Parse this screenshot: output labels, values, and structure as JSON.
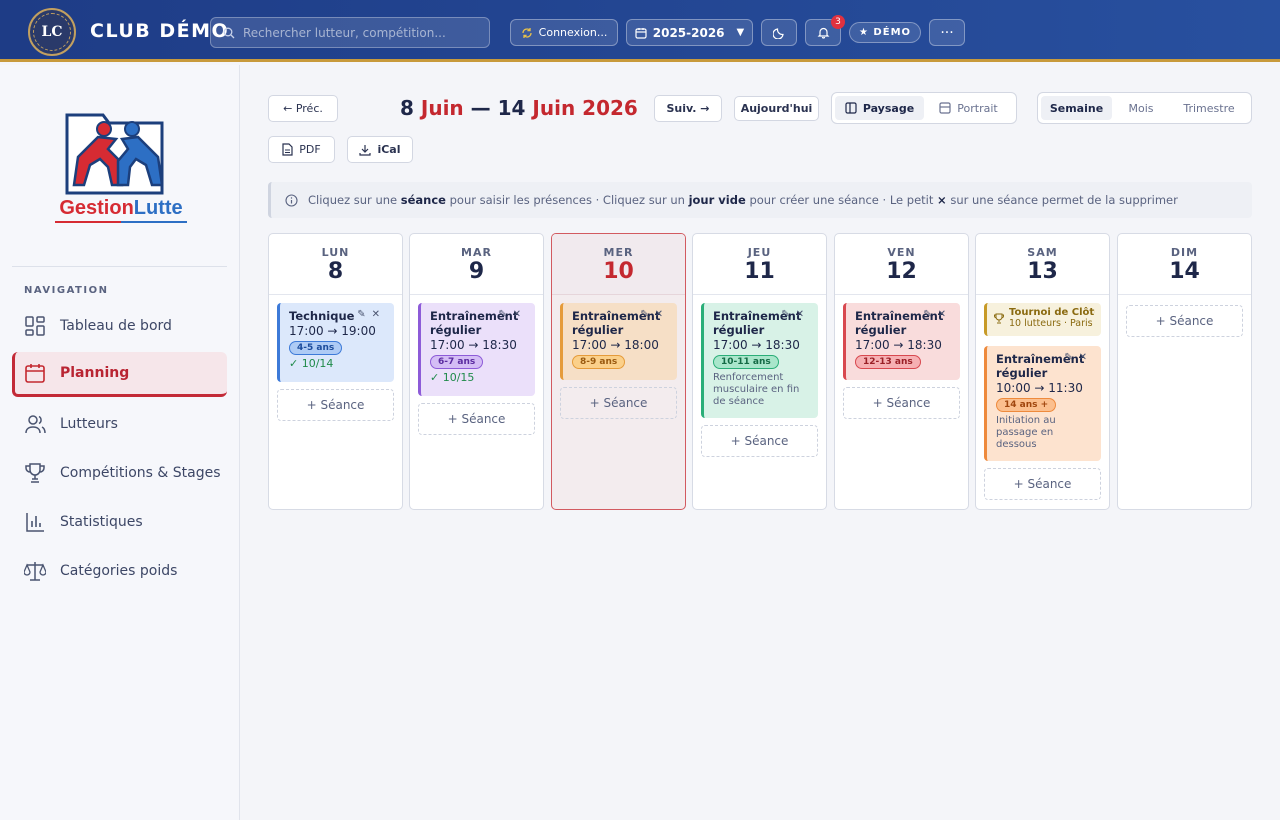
{
  "topbar": {
    "logo_initials": "LC",
    "club_name": "CLUB DÉMO",
    "search_placeholder": "Rechercher lutteur, compétition...",
    "connect_label": "Connexion...",
    "season_label": "2025-2026",
    "notifications_count": "3",
    "demo_badge": "★ DÉMO"
  },
  "colors": {
    "brand_blue": "#1e3c86",
    "accent_red": "#c4282f",
    "gold": "#c89a3c"
  },
  "sidebar": {
    "logo_text_a": "Gestion",
    "logo_text_b": "Lutte",
    "nav_caption": "NAVIGATION",
    "items": [
      {
        "label": "Tableau de bord",
        "icon": "dashboard-icon"
      },
      {
        "label": "Planning",
        "icon": "calendar-icon",
        "active": true
      },
      {
        "label": "Lutteurs",
        "icon": "users-icon"
      },
      {
        "label": "Compétitions & Stages",
        "icon": "trophy-icon"
      },
      {
        "label": "Statistiques",
        "icon": "stats-icon"
      },
      {
        "label": "Catégories poids",
        "icon": "scale-icon"
      }
    ]
  },
  "toolbar": {
    "prev_label": "← Préc.",
    "next_label": "Suiv. →",
    "today_label": "Aujourd'hui",
    "title_start_day": "8",
    "title_start_month": "Juin",
    "title_sep": "—",
    "title_end_day": "14",
    "title_end_month": "Juin 2026",
    "orientation": [
      "Paysage",
      "Portrait"
    ],
    "orientation_selected": "Paysage",
    "periods": [
      "Semaine",
      "Mois",
      "Trimestre"
    ],
    "period_selected": "Semaine",
    "pdf_label": "PDF",
    "ical_label": "iCal"
  },
  "info": {
    "t1": "Cliquez sur une",
    "b1": "séance",
    "t2": "pour saisir les présences · Cliquez sur un",
    "b2": "jour vide",
    "t3": "pour créer une séance · Le petit",
    "b3": "×",
    "t4": "sur une séance permet de la supprimer"
  },
  "add_session_label": "+ Séance",
  "days": [
    {
      "name": "LUN",
      "num": "8",
      "events": [
        {
          "title": "Technique",
          "time": "17:00 → 19:00",
          "age": "4-5 ans",
          "attendance": "✓ 10/14",
          "color": "blue"
        }
      ]
    },
    {
      "name": "MAR",
      "num": "9",
      "events": [
        {
          "title": "Entraînement régulier",
          "time": "17:00 → 18:30",
          "age": "6-7 ans",
          "attendance": "✓ 10/15",
          "color": "purple"
        }
      ]
    },
    {
      "name": "MER",
      "num": "10",
      "today": true,
      "events": [
        {
          "title": "Entraînement régulier",
          "time": "17:00 → 18:00",
          "age": "8-9 ans",
          "color": "orange"
        }
      ]
    },
    {
      "name": "JEU",
      "num": "11",
      "events": [
        {
          "title": "Entraînement régulier",
          "time": "17:00 → 18:30",
          "age": "10-11 ans",
          "note": "Renforcement musculaire en fin de séance",
          "color": "green"
        }
      ]
    },
    {
      "name": "VEN",
      "num": "12",
      "events": [
        {
          "title": "Entraînement régulier",
          "time": "17:00 → 18:30",
          "age": "12-13 ans",
          "color": "red"
        }
      ]
    },
    {
      "name": "SAM",
      "num": "13",
      "tournament": {
        "title": "Tournoi de Clôture",
        "sub": "10 lutteurs · Paris"
      },
      "events": [
        {
          "title": "Entraînement régulier",
          "time": "10:00 → 11:30",
          "age": "14 ans +",
          "note": "Initiation au passage en dessous",
          "color": "peach"
        }
      ]
    },
    {
      "name": "DIM",
      "num": "14",
      "events": []
    }
  ]
}
